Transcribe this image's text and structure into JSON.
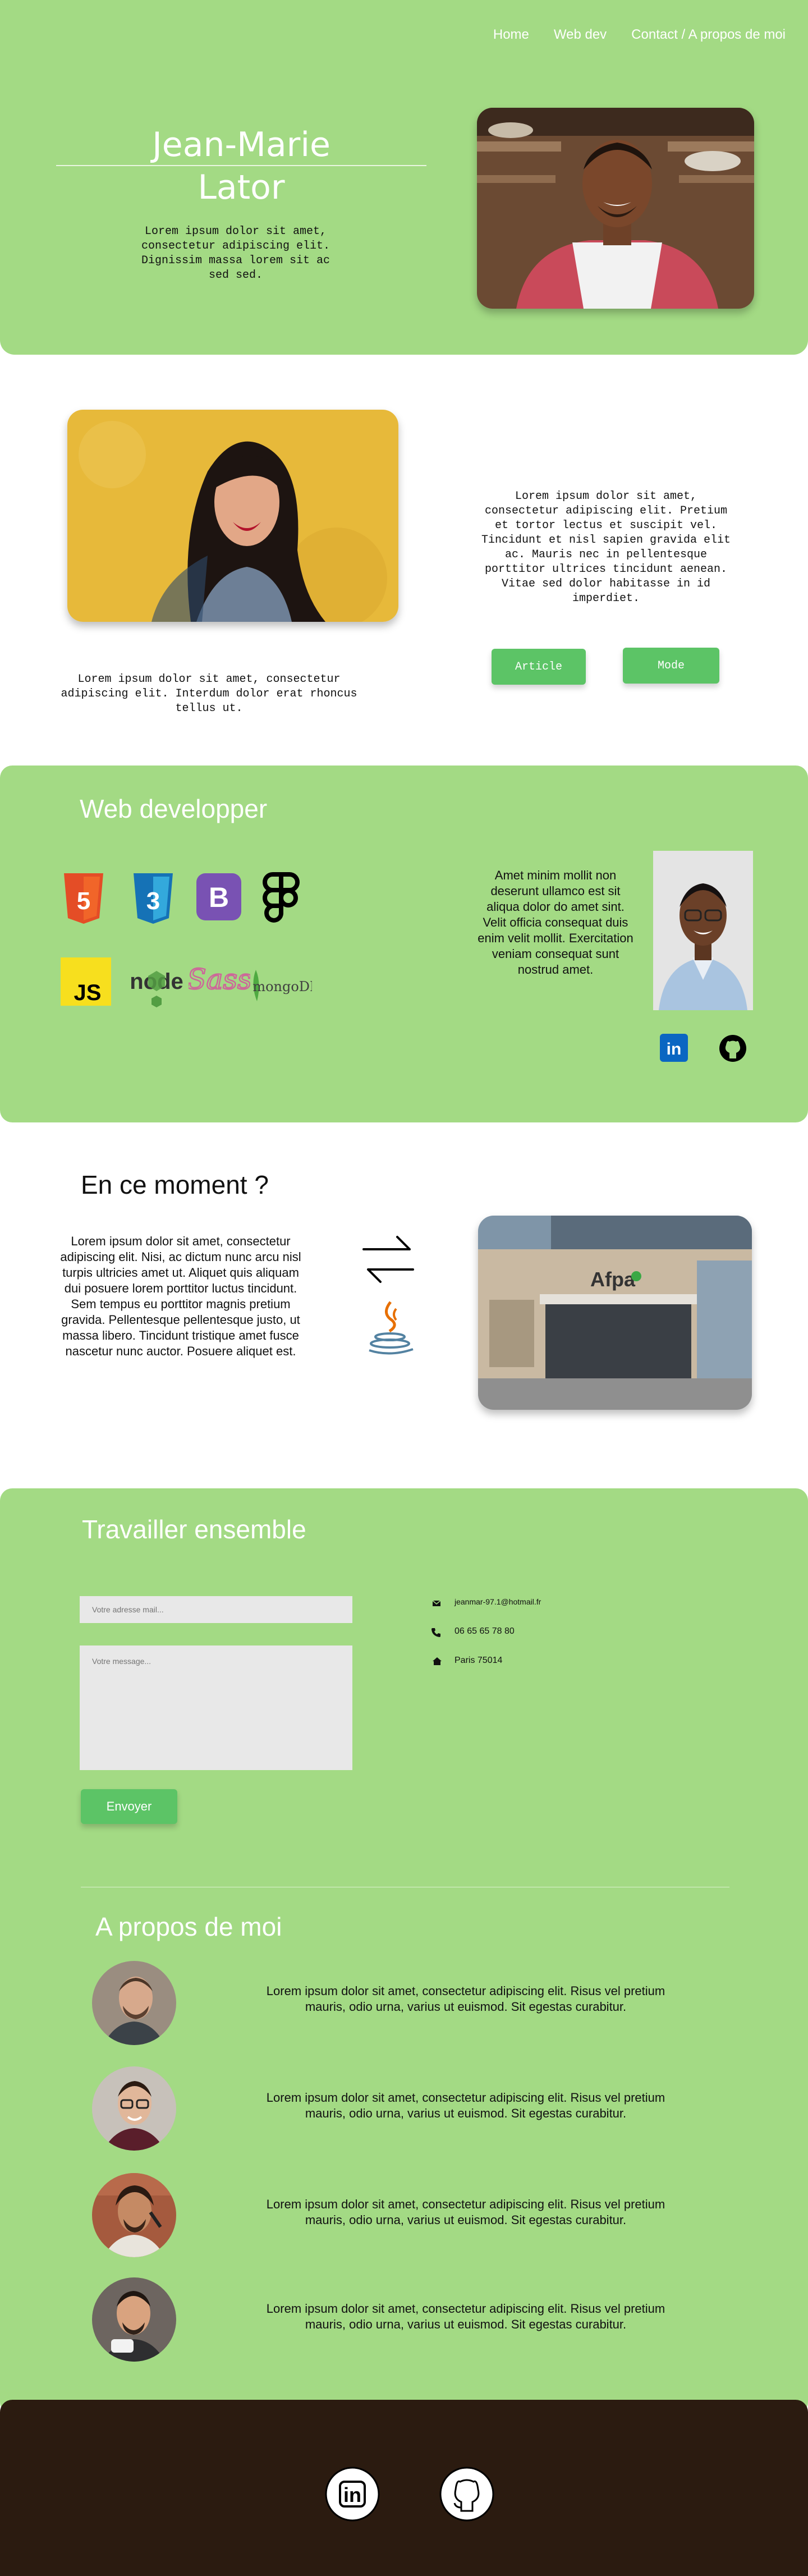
{
  "nav": {
    "items": [
      "Home",
      "Web dev",
      "Contact / A propos de moi"
    ]
  },
  "hero": {
    "name_line1": "Jean-Marie",
    "name_line2": "Lator",
    "text": "Lorem ipsum dolor sit amet, consectetur adipiscing elit. Dignissim massa lorem sit ac sed sed."
  },
  "intro": {
    "caption": "Lorem ipsum dolor sit amet, consectetur adipiscing elit. Interdum dolor erat rhoncus tellus ut.",
    "text": "Lorem ipsum dolor sit amet, consectetur adipiscing elit. Pretium et tortor lectus et suscipit vel. Tincidunt et nisl sapien gravida elit ac. Mauris nec in pellentesque porttitor ultrices tincidunt aenean. Vitae sed dolor habitasse in id imperdiet.",
    "article_button": "Article",
    "mode_button": "Mode"
  },
  "webdev": {
    "title": "Web developper",
    "tech_icons": [
      "html5-icon",
      "css3-icon",
      "bootstrap-icon",
      "figma-icon",
      "javascript-icon",
      "nodejs-icon",
      "sass-icon",
      "mongodb-icon"
    ],
    "html5": "5",
    "css3": "3",
    "bootstrap": "B",
    "js": "JS",
    "node": "node",
    "sass": "Sass",
    "mongo": "mongoDB",
    "text": "Amet minim mollit non deserunt ullamco est sit aliqua dolor do amet sint. Velit officia consequat duis enim velit mollit. Exercitation veniam consequat sunt nostrud amet.",
    "linkedin": "in"
  },
  "now": {
    "title": "En ce moment ?",
    "text": "Lorem ipsum dolor sit amet, consectetur adipiscing elit. Nisi, ac dictum nunc arcu nisl turpis ultricies amet ut. Aliquet quis aliquam dui posuere lorem porttitor luctus tincidunt. Sem tempus eu porttitor magnis pretium gravida. Pellentesque pellentesque justo, ut massa libero. Tincidunt tristique amet fusce nascetur nunc auctor. Posuere aliquet est.",
    "building_sign": "Afpa"
  },
  "contact": {
    "title": "Travailler ensemble",
    "email_placeholder": "Votre adresse mail...",
    "message_placeholder": "Votre message...",
    "send_button": "Envoyer",
    "email": "jeanmar-97.1@hotmail.fr",
    "phone": "06 65 65 78 80",
    "city": "Paris 75014"
  },
  "about": {
    "title": "A propos de moi",
    "items": [
      "Lorem ipsum dolor sit amet, consectetur adipiscing elit. Risus vel pretium mauris, odio urna, varius ut euismod. Sit egestas curabitur.",
      "Lorem ipsum dolor sit amet, consectetur adipiscing elit. Risus vel pretium mauris, odio urna, varius ut euismod. Sit egestas curabitur.",
      "Lorem ipsum dolor sit amet, consectetur adipiscing elit. Risus vel pretium mauris, odio urna, varius ut euismod. Sit egestas curabitur.",
      "Lorem ipsum dolor sit amet, consectetur adipiscing elit. Risus vel pretium mauris, odio urna, varius ut euismod. Sit egestas curabitur."
    ]
  },
  "footer": {
    "linkedin": "in"
  },
  "colors": {
    "green": "#a3da84",
    "button": "#5cc466",
    "footer": "#2b1b10"
  }
}
